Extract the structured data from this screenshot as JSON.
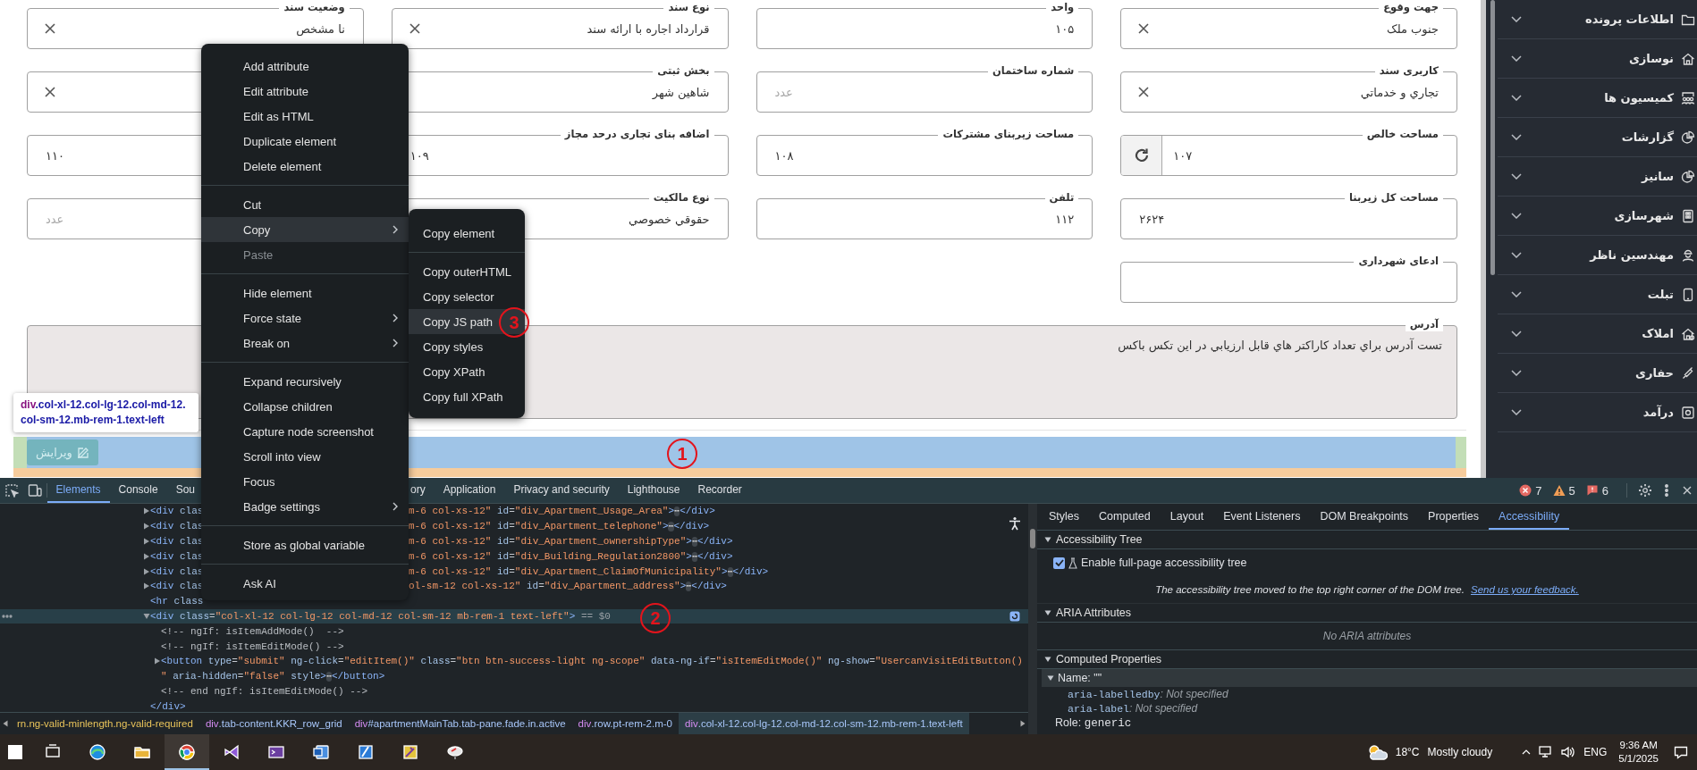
{
  "page": {
    "fields": [
      {
        "label": "جهت وقوع",
        "value": "جنوب ملک",
        "kind": "select",
        "ltr": false
      },
      {
        "label": "واحد",
        "value": "۱۰۵",
        "kind": "input",
        "ltr": false
      },
      {
        "label": "نوع سند",
        "value": "قرارداد اجاره با ارائه سند",
        "kind": "select",
        "ltr": false
      },
      {
        "label": "وضعیت سند",
        "value": "نا مشخص",
        "kind": "select",
        "ltr": false
      },
      {
        "label": "کاربری سند",
        "value": "تجاري و خدماتي",
        "kind": "select",
        "ltr": false
      },
      {
        "label": "شماره ساختمان",
        "placeholder": "عدد",
        "kind": "input",
        "ltr": true
      },
      {
        "label": "بخش ثبتی",
        "value": "شاهین شهر",
        "kind": "input",
        "ltr": false
      },
      {
        "kind": "select"
      },
      {
        "label": "مساحت خالص",
        "value": "۱۰۷",
        "kind": "refresh",
        "ltr": true
      },
      {
        "label": "مساحت زیربنای مشترکات",
        "value": "۱۰۸",
        "kind": "input",
        "ltr": true
      },
      {
        "label": "اضافه بنای تجاری درحد مجاز",
        "value": "۱۰۹",
        "kind": "input",
        "ltr": true
      },
      {
        "value": "۱۱۰",
        "kind": "input",
        "ltr": true
      },
      {
        "label": "مساحت کل زیربنا",
        "value": "۲۶۲۴",
        "kind": "input",
        "ltr": true
      },
      {
        "label": "تلفن",
        "value": "۱۱۲",
        "kind": "input",
        "ltr": false
      },
      {
        "label": "نوع مالکیت",
        "value": "حقوقي خصوصي",
        "kind": "input",
        "ltr": false
      },
      {
        "placeholder": "عدد",
        "kind": "input",
        "ltr": true
      },
      {
        "label": "ادعای شهرداری",
        "kind": "input"
      }
    ],
    "address": {
      "label": "آدرس",
      "value": "تست آدرس براي تعداد کاراکتر هاي قابل ارزيابي در اين تکس باکس"
    },
    "edit_button": {
      "label": "ویرایش"
    }
  },
  "sidebar": {
    "items": [
      {
        "label": "اطلاعات پرونده",
        "expanded": false
      },
      {
        "label": "نوسازی",
        "expanded": false
      },
      {
        "label": "کمیسیون ها",
        "expanded": false
      },
      {
        "label": "گزارشات",
        "expanded": false
      },
      {
        "label": "سانیز",
        "expanded": false
      },
      {
        "label": "شهرسازی",
        "expanded": false
      },
      {
        "label": "مهندسین ناظر",
        "expanded": false
      },
      {
        "label": "تبلت",
        "expanded": false
      },
      {
        "label": "املاک",
        "expanded": false
      },
      {
        "label": "حفاری",
        "expanded": false
      },
      {
        "label": "درآمد",
        "expanded": false
      }
    ]
  },
  "devtools": {
    "tabs": [
      {
        "label": "Elements",
        "selected": true
      },
      {
        "label": "Console",
        "selected": false
      },
      {
        "label": "Sou",
        "selected": false
      },
      {
        "label": "ory",
        "selected": false
      },
      {
        "label": "Application",
        "selected": false
      },
      {
        "label": "Privacy and security",
        "selected": false
      },
      {
        "label": "Lighthouse",
        "selected": false
      },
      {
        "label": "Recorder",
        "selected": false
      }
    ],
    "counts": {
      "errors": "7",
      "warnings": "5",
      "issues": "6"
    },
    "dom_tree": [
      {
        "expanded": false,
        "selected": false,
        "rows": [
          {
            "left": [
              {
                "text": "<div ",
                "kind": "tag"
              },
              {
                "text": "clas",
                "kind": "attr"
              }
            ],
            "right": [
              {
                "text": "m-6 col-xs-12\"",
                "kind": "value"
              },
              {
                "text": " id",
                "kind": "attr"
              },
              {
                "text": "=",
                "kind": "punct"
              },
              {
                "text": "\"div_Apartment_Usage_Area\"",
                "kind": "value"
              },
              {
                "text": ">",
                "kind": "tag"
              },
              {
                "text": "⋯",
                "kind": "ellipsis"
              },
              {
                "text": "</div>",
                "kind": "tag"
              }
            ]
          }
        ]
      },
      {
        "expanded": false,
        "selected": false,
        "rows": [
          {
            "left": [
              {
                "text": "<div ",
                "kind": "tag"
              },
              {
                "text": "clas",
                "kind": "attr"
              }
            ],
            "right": [
              {
                "text": "m-6 col-xs-12\"",
                "kind": "value"
              },
              {
                "text": " id",
                "kind": "attr"
              },
              {
                "text": "=",
                "kind": "punct"
              },
              {
                "text": "\"div_Apartment_telephone\"",
                "kind": "value"
              },
              {
                "text": ">",
                "kind": "tag"
              },
              {
                "text": "⋯",
                "kind": "ellipsis"
              },
              {
                "text": "</div>",
                "kind": "tag"
              }
            ]
          }
        ]
      },
      {
        "expanded": false,
        "selected": false,
        "rows": [
          {
            "left": [
              {
                "text": "<div ",
                "kind": "tag"
              },
              {
                "text": "clas",
                "kind": "attr"
              }
            ],
            "right": [
              {
                "text": "m-6 col-xs-12\"",
                "kind": "value"
              },
              {
                "text": " id",
                "kind": "attr"
              },
              {
                "text": "=",
                "kind": "punct"
              },
              {
                "text": "\"div_Apartment_ownershipType\"",
                "kind": "value"
              },
              {
                "text": ">",
                "kind": "tag"
              },
              {
                "text": "⋯",
                "kind": "ellipsis"
              },
              {
                "text": "</div>",
                "kind": "tag"
              }
            ]
          }
        ]
      },
      {
        "expanded": false,
        "selected": false,
        "rows": [
          {
            "left": [
              {
                "text": "<div ",
                "kind": "tag"
              },
              {
                "text": "clas",
                "kind": "attr"
              }
            ],
            "right": [
              {
                "text": "m-6 col-xs-12\"",
                "kind": "value"
              },
              {
                "text": " id",
                "kind": "attr"
              },
              {
                "text": "=",
                "kind": "punct"
              },
              {
                "text": "\"div_Building_Regulation2800\"",
                "kind": "value"
              },
              {
                "text": ">",
                "kind": "tag"
              },
              {
                "text": "⋯",
                "kind": "ellipsis"
              },
              {
                "text": "</div>",
                "kind": "tag"
              }
            ]
          }
        ]
      },
      {
        "expanded": false,
        "selected": false,
        "rows": [
          {
            "left": [
              {
                "text": "<div ",
                "kind": "tag"
              },
              {
                "text": "clas",
                "kind": "attr"
              }
            ],
            "right": [
              {
                "text": "m-6 col-xs-12\"",
                "kind": "value"
              },
              {
                "text": " id",
                "kind": "attr"
              },
              {
                "text": "=",
                "kind": "punct"
              },
              {
                "text": "\"div_Apartment_ClaimOfMunicipality\"",
                "kind": "value"
              },
              {
                "text": ">",
                "kind": "tag"
              },
              {
                "text": "⋯",
                "kind": "ellipsis"
              },
              {
                "text": "</div>",
                "kind": "tag"
              }
            ]
          }
        ]
      },
      {
        "expanded": false,
        "selected": false,
        "rows": [
          {
            "left": [
              {
                "text": "<div ",
                "kind": "tag"
              },
              {
                "text": "clas",
                "kind": "attr"
              }
            ],
            "right": [
              {
                "text": "ol-sm-12 col-xs-12\"",
                "kind": "value"
              },
              {
                "text": " id",
                "kind": "attr"
              },
              {
                "text": "=",
                "kind": "punct"
              },
              {
                "text": "\"div_Apartment_address\"",
                "kind": "value"
              },
              {
                "text": ">",
                "kind": "tag"
              },
              {
                "text": "⋯",
                "kind": "ellipsis"
              },
              {
                "text": "</div>",
                "kind": "tag"
              }
            ]
          }
        ]
      },
      {
        "selected": false,
        "rows": [
          {
            "left": [
              {
                "text": "<hr ",
                "kind": "tag"
              },
              {
                "text": "class",
                "kind": "attr"
              }
            ]
          }
        ]
      },
      {
        "expanded": true,
        "selected": true,
        "rows": [
          {
            "left": [
              {
                "text": "<div ",
                "kind": "tag"
              },
              {
                "text": "class",
                "kind": "attr"
              },
              {
                "text": "=",
                "kind": "punct"
              },
              {
                "text": "\"col-xl-12 col-lg-12 col-md-12 col-sm-12 mb-rem-1 text-left\"",
                "kind": "value"
              },
              {
                "text": ">",
                "kind": "tag"
              },
              {
                "text": " == $0",
                "kind": "plain"
              }
            ]
          }
        ],
        "children": [
          {
            "selected": false,
            "rows": [
              {
                "left": [
                  {
                    "text": "<!-- ngIf: isItemAddMode()  -->",
                    "kind": "comment"
                  }
                ]
              }
            ]
          },
          {
            "selected": false,
            "rows": [
              {
                "left": [
                  {
                    "text": "<!-- ngIf: isItemEditMode() -->",
                    "kind": "comment"
                  }
                ]
              }
            ]
          },
          {
            "expanded": false,
            "selected": false,
            "rows": [
              {
                "left": [
                  {
                    "text": "<button ",
                    "kind": "tag"
                  },
                  {
                    "text": "type",
                    "kind": "attr"
                  },
                  {
                    "text": "=",
                    "kind": "punct"
                  },
                  {
                    "text": "\"submit\"",
                    "kind": "value"
                  },
                  {
                    "text": " ng-click",
                    "kind": "attr"
                  },
                  {
                    "text": "=",
                    "kind": "punct"
                  },
                  {
                    "text": "\"editItem()\"",
                    "kind": "value"
                  },
                  {
                    "text": " class",
                    "kind": "attr"
                  },
                  {
                    "text": "=",
                    "kind": "punct"
                  },
                  {
                    "text": "\"btn btn-success-light ng-scope\"",
                    "kind": "value"
                  },
                  {
                    "text": " data-ng-if",
                    "kind": "attr"
                  },
                  {
                    "text": "=",
                    "kind": "punct"
                  },
                  {
                    "text": "\"isItemEditMode()\"",
                    "kind": "value"
                  },
                  {
                    "text": " ng-show",
                    "kind": "attr"
                  },
                  {
                    "text": "=",
                    "kind": "punct"
                  },
                  {
                    "text": "\"UsercanVisitEditButton()",
                    "kind": "value"
                  }
                ]
              },
              {
                "left": [
                  {
                    "text": "\"",
                    "kind": "value"
                  },
                  {
                    "text": " aria-hidden",
                    "kind": "attr"
                  },
                  {
                    "text": "=",
                    "kind": "punct"
                  },
                  {
                    "text": "\"false\"",
                    "kind": "value"
                  },
                  {
                    "text": " style",
                    "kind": "attr"
                  },
                  {
                    "text": ">",
                    "kind": "tag"
                  },
                  {
                    "text": "⋯",
                    "kind": "ellipsis"
                  },
                  {
                    "text": "</button>",
                    "kind": "tag"
                  }
                ]
              }
            ]
          },
          {
            "selected": false,
            "rows": [
              {
                "left": [
                  {
                    "text": "<!-- end ngIf: isItemEditMode() -->",
                    "kind": "comment"
                  }
                ]
              }
            ]
          }
        ],
        "closing": [
          {
            "text": "</div>",
            "kind": "tag"
          }
        ]
      }
    ],
    "breadcrumbs": [
      {
        "selector": "rn.ng-valid-minlength.ng-valid-required",
        "selected": false
      },
      {
        "tag": "div",
        "selector": ".tab-content.KKR_row_grid",
        "selected": false
      },
      {
        "tag": "div",
        "selector": "#apartmentMainTab.tab-pane.fade.in.active",
        "selected": false
      },
      {
        "tag": "div",
        "selector": ".row.pt-rem-2.m-0",
        "selected": false
      },
      {
        "tag": "div",
        "selector": ".col-xl-12.col-lg-12.col-md-12.col-sm-12.mb-rem-1.text-left",
        "selected": true
      }
    ],
    "side_tabs": [
      {
        "label": "Styles",
        "selected": false
      },
      {
        "label": "Computed",
        "selected": false
      },
      {
        "label": "Layout",
        "selected": false
      },
      {
        "label": "Event Listeners",
        "selected": false
      },
      {
        "label": "DOM Breakpoints",
        "selected": false
      },
      {
        "label": "Properties",
        "selected": false
      },
      {
        "label": "Accessibility",
        "selected": true
      }
    ],
    "accessibility_tree": {
      "title": "Accessibility Tree",
      "expanded": true,
      "checkbox": {
        "label": "Enable full-page accessibility tree",
        "checked": true
      },
      "note": "The accessibility tree moved to the top right corner of the DOM tree.",
      "link": "Send us your feedback."
    },
    "aria_attributes": {
      "title": "ARIA Attributes",
      "expanded": true,
      "empty_text": "No ARIA attributes"
    },
    "computed_properties": {
      "title": "Computed Properties",
      "expanded": true,
      "name": {
        "label": "Name: \"\"",
        "expanded": true
      },
      "properties": [
        {
          "name": "aria-labelledby",
          "separator": ":",
          "value": "Not specified"
        },
        {
          "name": "aria-label",
          "separator": ":",
          "value": "Not specified"
        }
      ],
      "role": {
        "label": "Role:",
        "value": "generic"
      }
    }
  },
  "context_menu": {
    "groups": [
      [
        {
          "label": "Add attribute",
          "highlighted": false,
          "disabled": false,
          "submenu": false
        },
        {
          "label": "Edit attribute",
          "highlighted": false,
          "disabled": false,
          "submenu": false
        },
        {
          "label": "Edit as HTML",
          "highlighted": false,
          "disabled": false,
          "submenu": false
        },
        {
          "label": "Duplicate element",
          "highlighted": false,
          "disabled": false,
          "submenu": false
        },
        {
          "label": "Delete element",
          "highlighted": false,
          "disabled": false,
          "submenu": false
        }
      ],
      [
        {
          "label": "Cut",
          "highlighted": false,
          "disabled": false,
          "submenu": false
        },
        {
          "label": "Copy",
          "highlighted": true,
          "disabled": false,
          "submenu": true
        },
        {
          "label": "Paste",
          "highlighted": false,
          "disabled": true,
          "submenu": false
        }
      ],
      [
        {
          "label": "Hide element",
          "highlighted": false,
          "disabled": false,
          "submenu": false
        },
        {
          "label": "Force state",
          "highlighted": false,
          "disabled": false,
          "submenu": true
        },
        {
          "label": "Break on",
          "highlighted": false,
          "disabled": false,
          "submenu": true
        }
      ],
      [
        {
          "label": "Expand recursively",
          "highlighted": false,
          "disabled": false,
          "submenu": false
        },
        {
          "label": "Collapse children",
          "highlighted": false,
          "disabled": false,
          "submenu": false
        },
        {
          "label": "Capture node screenshot",
          "highlighted": false,
          "disabled": false,
          "submenu": false
        },
        {
          "label": "Scroll into view",
          "highlighted": false,
          "disabled": false,
          "submenu": false
        },
        {
          "label": "Focus",
          "highlighted": false,
          "disabled": false,
          "submenu": false
        },
        {
          "label": "Badge settings",
          "highlighted": false,
          "disabled": false,
          "submenu": true
        }
      ],
      [
        {
          "label": "Store as global variable",
          "highlighted": false,
          "disabled": false,
          "submenu": false
        }
      ],
      [
        {
          "label": "Ask AI",
          "highlighted": false,
          "disabled": false,
          "submenu": false
        }
      ]
    ]
  },
  "copy_submenu": {
    "groups": [
      [
        {
          "label": "Copy element",
          "highlighted": false,
          "disabled": false,
          "submenu": false
        }
      ],
      [
        {
          "label": "Copy outerHTML",
          "highlighted": false,
          "disabled": false,
          "submenu": false
        },
        {
          "label": "Copy selector",
          "highlighted": false,
          "disabled": false,
          "submenu": false
        },
        {
          "label": "Copy JS path",
          "highlighted": true,
          "disabled": false,
          "submenu": false
        },
        {
          "label": "Copy styles",
          "highlighted": false,
          "disabled": false,
          "submenu": false
        },
        {
          "label": "Copy XPath",
          "highlighted": false,
          "disabled": false,
          "submenu": false
        },
        {
          "label": "Copy full XPath",
          "highlighted": false,
          "disabled": false,
          "submenu": false
        }
      ]
    ]
  },
  "element_tooltip": {
    "tag": "div",
    "selector": ".col-xl-12.col-lg-12.col-md-12.col-sm-12.mb-rem-1.text-left"
  },
  "annotations": [
    {
      "label": "1"
    },
    {
      "label": "2"
    },
    {
      "label": "3"
    }
  ],
  "taskbar": {
    "weather": {
      "temperature": "18°C",
      "condition": "Mostly cloudy"
    },
    "language": "ENG",
    "time": "9:36 AM",
    "date": "5/1/2025"
  }
}
